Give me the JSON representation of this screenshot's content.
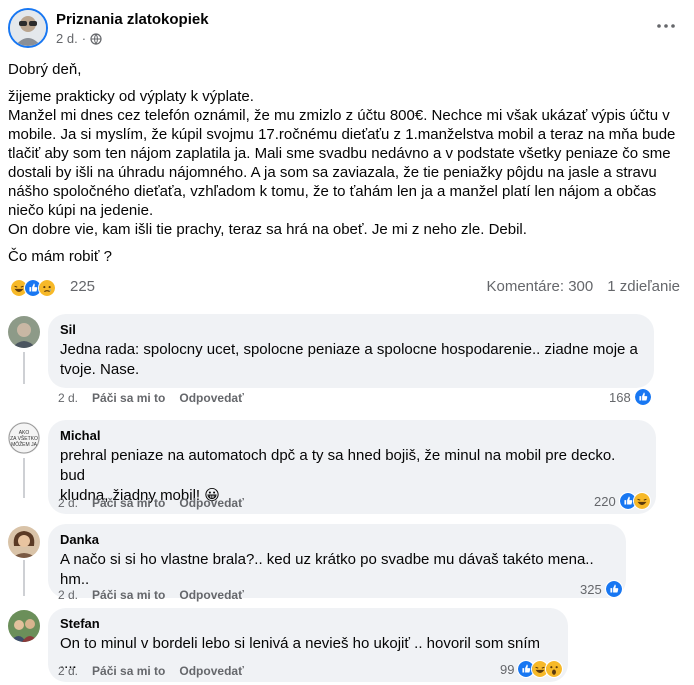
{
  "post": {
    "page_name": "Priznania zlatokopiek",
    "time": "2 d.",
    "greeting": "Dobrý deň,",
    "body": "žijeme prakticky od výplaty k výplate.\nManžel mi dnes cez telefón oznámil, že mu zmizlo z účtu 800€. Nechce mi však ukázať výpis účtu v mobile. Ja si myslím, že kúpil svojmu 17.ročnému dieťaťu z 1.manželstva mobil a teraz na mňa bude tlačiť aby som ten nájom zaplatila ja. Mali sme svadbu nedávno a v podstate všetky peniaze čo sme dostali by išli na úhradu nájomného. A ja som sa zaviazala, že tie peniažky pôjdu na jasle a stravu nášho spoločného dieťaťa, vzhľadom k tomu, že to ťahám len ja a manžel platí len nájom a občas niečo kúpi na jedenie.\nOn dobre vie, kam išli tie prachy, teraz sa hrá na obeť. Je mi z neho zle. Debil.",
    "question": "Čo mám robiť ?",
    "reaction_count": "225",
    "comments_count": "Komentáre: 300",
    "shares_count": "1 zdieľanie"
  },
  "actions": {
    "like": "Páči sa mi to",
    "reply": "Odpovedať"
  },
  "comments": [
    {
      "name": "Sil",
      "text": "Jedna rada: spolocny ucet, spolocne peniaze a spolocne hospodarenie.. ziadne moje a\ntvoje. Nase.",
      "time": "2 d.",
      "likes": "168"
    },
    {
      "name": "Michal",
      "text": "prehral peniaze na automatoch dpč a ty sa hned bojiš, že minul na mobil pre decko. bud\nkludna, žiadny mobil! 😀",
      "time": "2 d.",
      "likes": "220"
    },
    {
      "name": "Danka",
      "text": "A načo si si ho vlastne brala?.. ked uz krátko po svadbe mu dávaš takéto mena.. hm..",
      "time": "2 d.",
      "likes": "325"
    },
    {
      "name": "Stefan",
      "text": "On to minul v bordeli lebo si lenivá a nevieš ho ukojiť .. hovoril som sním ....",
      "time": "2 d.",
      "likes": "99"
    }
  ],
  "colors": {
    "like_blue": "#1877f2",
    "bubble_bg": "#f0f2f5",
    "secondary_text": "#65676b"
  }
}
